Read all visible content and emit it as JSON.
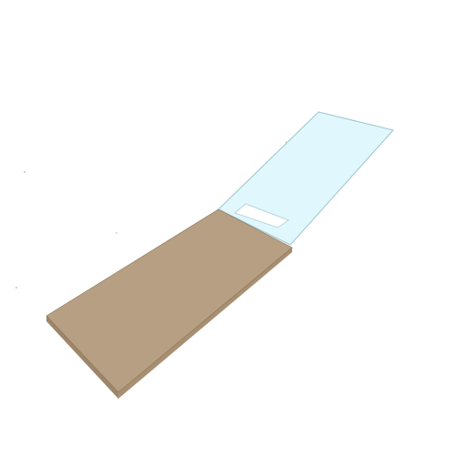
{
  "scene": {
    "background": "#ffffff",
    "objects": [
      {
        "name": "tan-slab",
        "top_color": "#b69f82",
        "front_color": "#9d866a",
        "side_color": "#a88f72",
        "edge_color": "#8a7258"
      },
      {
        "name": "light-blue-panel",
        "fill_color": "#dff7fd",
        "edge_color": "#9fc4cf",
        "cutout_color": "#ffffff"
      }
    ]
  }
}
